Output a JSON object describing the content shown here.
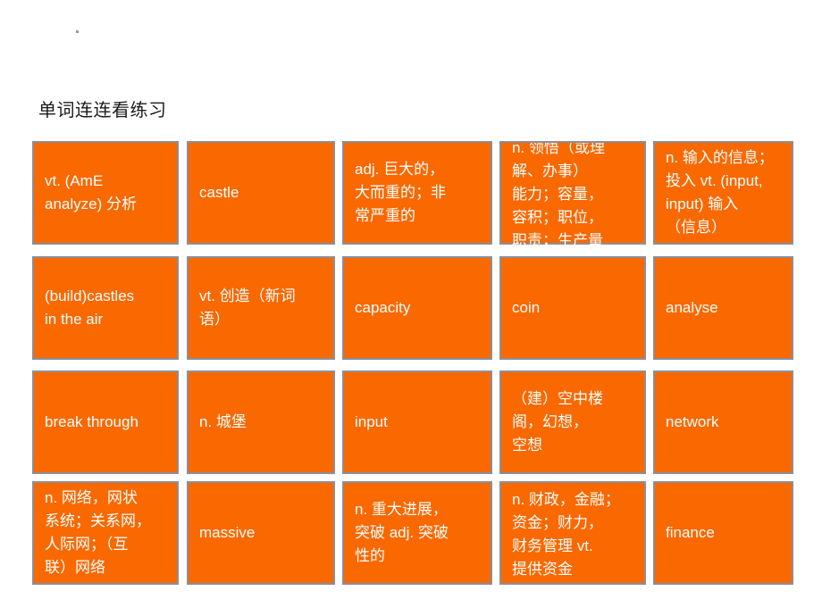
{
  "slide": {
    "title": "单词连连看练习",
    "background_color": "#ffffff",
    "card_color": "#fa6800",
    "card_border_color": "#8a8f9a",
    "card_text_color": "#ffffff",
    "title_color": "#1a1a1a"
  },
  "grid": {
    "rows": 4,
    "columns": 5,
    "cards": [
      [
        {
          "text": "vt. (AmE\nanalyze) 分析",
          "overflow": false
        },
        {
          "text": "castle",
          "overflow": false
        },
        {
          "text": "adj. 巨大的，\n大而重的；非\n常严重的",
          "overflow": false
        },
        {
          "text": "n. 领悟（或理\n解、办事）\n能力；容量，\n容积；职位，\n职责；生产量",
          "overflow": true
        },
        {
          "text": "n. 输入的信息；\n投入 vt. (input,\ninput) 输入\n（信息）",
          "overflow": false
        }
      ],
      [
        {
          "text": "(build)castles\nin the air",
          "overflow": false
        },
        {
          "text": "vt. 创造（新词\n语）",
          "overflow": false
        },
        {
          "text": "capacity",
          "overflow": false
        },
        {
          "text": "coin",
          "overflow": false
        },
        {
          "text": "analyse",
          "overflow": false
        }
      ],
      [
        {
          "text": "break through",
          "overflow": false
        },
        {
          "text": "n. 城堡",
          "overflow": false
        },
        {
          "text": "input",
          "overflow": false
        },
        {
          "text": "（建）空中楼\n阁，幻想，\n空想",
          "overflow": false
        },
        {
          "text": "network",
          "overflow": false
        }
      ],
      [
        {
          "text": "n. 网络，网状\n系统；关系网，\n人际网；（互\n联）网络",
          "overflow": false
        },
        {
          "text": "massive",
          "overflow": false
        },
        {
          "text": "n. 重大进展，\n突破 adj. 突破\n性的",
          "overflow": false
        },
        {
          "text": "n. 财政，金融；\n资金；财力，\n财务管理 vt.\n提供资金",
          "overflow": true
        },
        {
          "text": "finance",
          "overflow": false
        }
      ]
    ]
  }
}
